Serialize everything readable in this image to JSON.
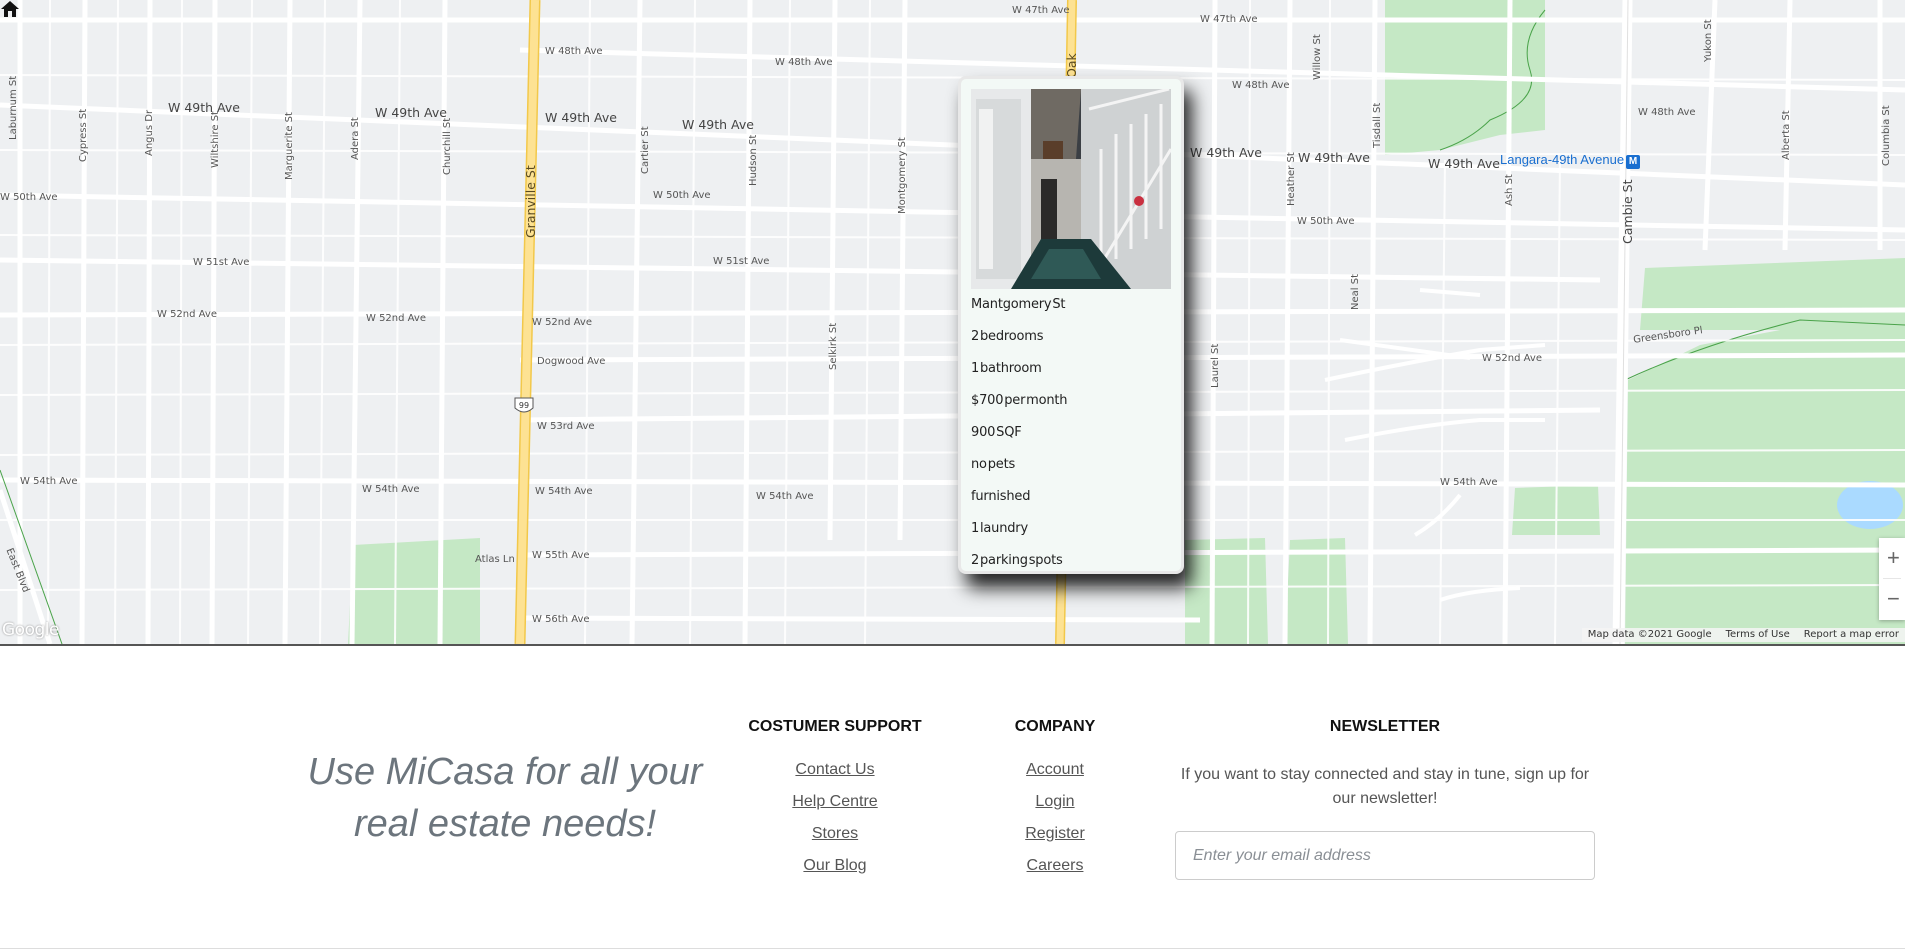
{
  "map": {
    "streets_h": [
      {
        "label": "W 47th Ave"
      },
      {
        "label": "W 47th Ave"
      },
      {
        "label": "W 48th Ave"
      },
      {
        "label": "W 48th Ave"
      },
      {
        "label": "W 48th Ave"
      },
      {
        "label": "W 48th Ave"
      },
      {
        "label": "W 49th Ave"
      },
      {
        "label": "W 49th Ave"
      },
      {
        "label": "W 49th Ave"
      },
      {
        "label": "W 49th Ave"
      },
      {
        "label": "W 49th Ave"
      },
      {
        "label": "W 49th Ave"
      },
      {
        "label": "W 49th Ave"
      },
      {
        "label": "W 50th Ave"
      },
      {
        "label": "W 50th Ave"
      },
      {
        "label": "W 50th Ave"
      },
      {
        "label": "W 51st Ave"
      },
      {
        "label": "W 51st Ave"
      },
      {
        "label": "W 52nd Ave"
      },
      {
        "label": "W 52nd Ave"
      },
      {
        "label": "W 52nd Ave"
      },
      {
        "label": "W 52nd Ave"
      },
      {
        "label": "Dogwood Ave"
      },
      {
        "label": "W 53rd Ave"
      },
      {
        "label": "W 54th Ave"
      },
      {
        "label": "W 54th Ave"
      },
      {
        "label": "W 54th Ave"
      },
      {
        "label": "W 54th Ave"
      },
      {
        "label": "W 54th Ave"
      },
      {
        "label": "W 55th Ave"
      },
      {
        "label": "Atlas Ln"
      },
      {
        "label": "W 56th Ave"
      },
      {
        "label": "Greensboro Pl"
      }
    ],
    "streets_v": [
      "Laburnum St",
      "Cypress St",
      "Angus Dr",
      "Wiltshire St",
      "Marguerite St",
      "Adera St",
      "Churchill St",
      "Granville St",
      "Cartier St",
      "Hudson St",
      "Selkirk St",
      "Montgomery St",
      "Oak",
      "Laurel St",
      "Heather St",
      "Tisdall St",
      "Willow St",
      "Neal St",
      "Ash St",
      "Cambie St",
      "Yukon St",
      "Alberta St",
      "Columbia St",
      "East Blvd"
    ],
    "highway_shield": "99",
    "transit_station": "Langara-49th Avenue",
    "transit_icon": "M",
    "attribution": {
      "map_data": "Map data ©2021 Google",
      "terms": "Terms of Use",
      "report": "Report a map error"
    },
    "google_logo": "Google",
    "zoom_in": "+",
    "zoom_out": "−",
    "home_marker_icon": "home-icon"
  },
  "listing": {
    "lines": [
      "Mantgomery St",
      "2 bedrooms",
      "1 bathroom",
      "$700 per month",
      "900 SQF",
      "no pets",
      "furnished",
      "1 laundry",
      "2 parking spots"
    ]
  },
  "footer": {
    "tagline": "Use MiCasa for all your real estate needs!",
    "support": {
      "heading": "COSTUMER SUPPORT",
      "links": [
        "Contact Us",
        "Help Centre",
        "Stores",
        "Our Blog"
      ]
    },
    "company": {
      "heading": "COMPANY",
      "links": [
        "Account",
        "Login",
        "Register",
        "Careers"
      ]
    },
    "newsletter": {
      "heading": "NEWSLETTER",
      "text": "If you want to stay connected and stay in tune, sign up for our newsletter!",
      "placeholder": "Enter your email address"
    }
  },
  "colors": {
    "map_bg": "#eef0f2",
    "park": "#c5e8c5",
    "highway": "#fde293",
    "water": "#aadaff",
    "popup_bg": "#f3f9f6"
  }
}
